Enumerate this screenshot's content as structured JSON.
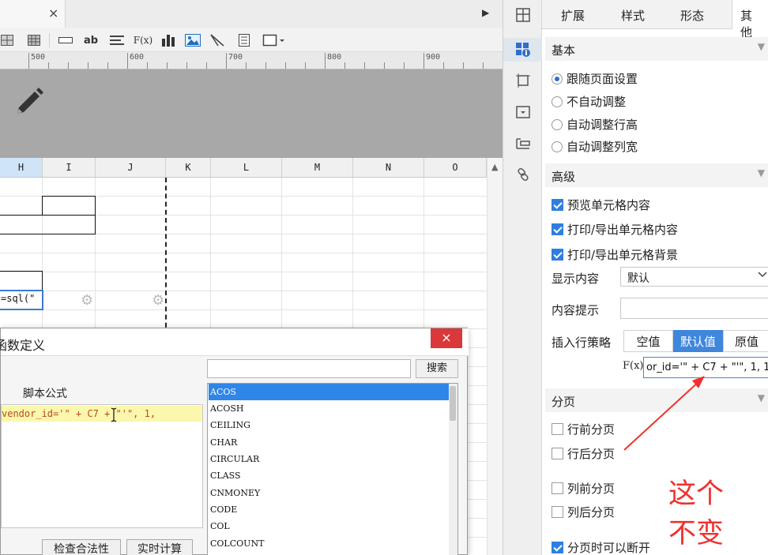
{
  "editor": {
    "ruler_marks": [
      "500",
      "600",
      "700",
      "800",
      "900"
    ],
    "columns": [
      "H",
      "I",
      "J",
      "K",
      "L",
      "M",
      "N",
      "O"
    ],
    "formula_cell_text": "=sql(\"",
    "tab_close": "×",
    "collapse_glyph": "▶"
  },
  "toolbar": {
    "text_tool": "ab",
    "fx_tool": "F(x)"
  },
  "dialog": {
    "title": "函数定义",
    "close_glyph": "×",
    "search_button": "搜索",
    "search_value": "",
    "script_label": "脚本公式",
    "script_line": "vendor_id='\" + C7 + \"'\", 1,",
    "check_button": "检查合法性",
    "realtime_button": "实时计算",
    "functions": [
      "ACOS",
      "ACOSH",
      "CEILING",
      "CHAR",
      "CIRCULAR",
      "CLASS",
      "CNMONEY",
      "CODE",
      "COL",
      "COLCOUNT"
    ],
    "selected_function": "ACOS"
  },
  "props": {
    "tabs": [
      "扩展",
      "样式",
      "形态",
      "其他"
    ],
    "active_tab": "其他",
    "section_basic": "基本",
    "radio_options": [
      {
        "label": "跟随页面设置",
        "checked": true
      },
      {
        "label": "不自动调整",
        "checked": false
      },
      {
        "label": "自动调整行高",
        "checked": false
      },
      {
        "label": "自动调整列宽",
        "checked": false
      }
    ],
    "section_advanced": "高级",
    "advanced_checks": [
      {
        "label": "预览单元格内容",
        "checked": true
      },
      {
        "label": "打印/导出单元格内容",
        "checked": true
      },
      {
        "label": "打印/导出单元格背景",
        "checked": true
      }
    ],
    "display_label": "显示内容",
    "display_value": "默认",
    "tooltip_label": "内容提示",
    "tooltip_value": "",
    "insert_label": "插入行策略",
    "insert_options": [
      "空值",
      "默认值",
      "原值"
    ],
    "insert_selected": "默认值",
    "fx_label": "F(x)",
    "formula_value": "or_id='\" + C7 + \"'\", 1, 1)",
    "section_paging": "分页",
    "paging_checks": [
      {
        "label": "行前分页",
        "checked": false
      },
      {
        "label": "行后分页",
        "checked": false
      },
      {
        "label": "列前分页",
        "checked": false
      },
      {
        "label": "列后分页",
        "checked": false
      },
      {
        "label": "分页时可以断开",
        "checked": true
      }
    ],
    "collapse_glyph": "▼"
  },
  "annotation": {
    "line1": "这个",
    "line2": "不变",
    "color": "#f0312d"
  },
  "colors": {
    "accent": "#3f86dc",
    "selection": "#2f86e8",
    "close_red": "#d9393a"
  }
}
